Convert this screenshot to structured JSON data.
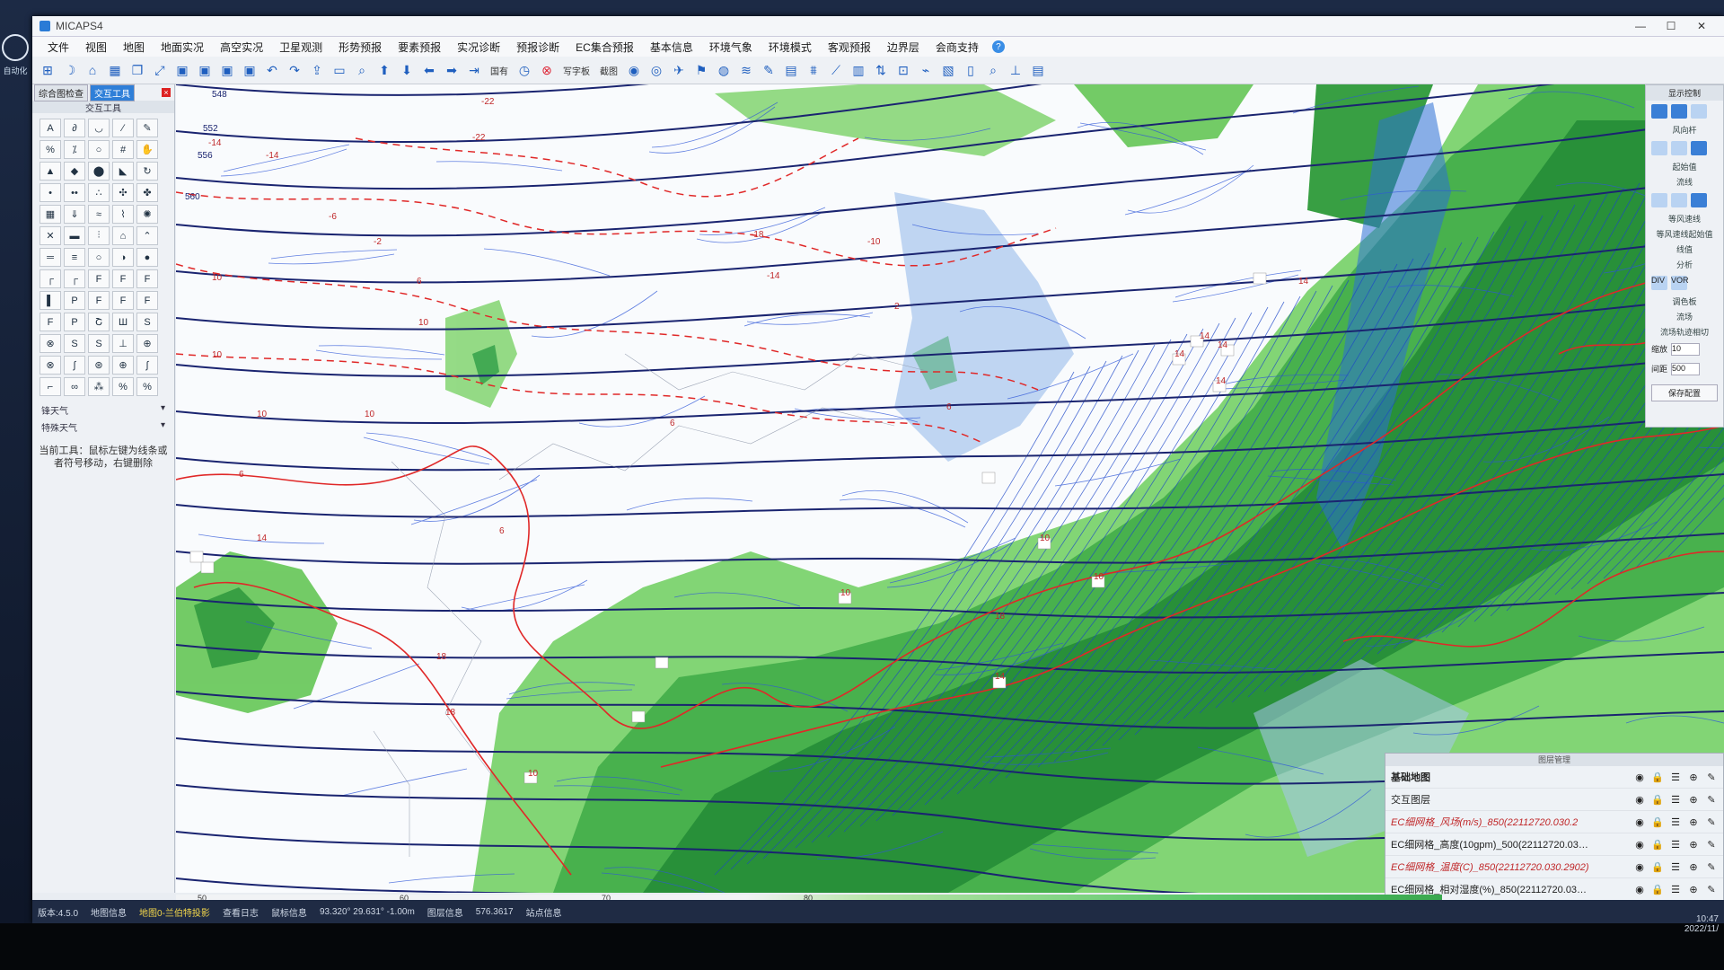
{
  "window": {
    "title": "MICAPS4"
  },
  "desktop": {
    "left_icon_label": "自动化"
  },
  "menu": [
    "文件",
    "视图",
    "地图",
    "地面实况",
    "高空实况",
    "卫星观测",
    "形势预报",
    "要素预报",
    "实况诊断",
    "预报诊断",
    "EC集合预报",
    "基本信息",
    "环境气象",
    "环境模式",
    "客观预报",
    "边界层",
    "会商支持"
  ],
  "toolbar": {
    "text_a": "国有",
    "text_b": "写字板",
    "text_c": "截图"
  },
  "left_panel": {
    "tabs": [
      "综合图检查",
      "交互工具"
    ],
    "header": "交互工具",
    "tool_glyphs": [
      "A",
      "∂",
      "◡",
      "∕",
      "✎",
      "%",
      "⁒",
      "○",
      "#",
      "✋",
      "▲",
      "◆",
      "⬤",
      "◣",
      "↻",
      "•",
      "••",
      "∴",
      "✣",
      "✤",
      "▦",
      "⇓",
      "≈",
      "⌇",
      "✺",
      "✕",
      "▬",
      "⫶",
      "⌂",
      "⌃",
      "═",
      "≡",
      "○",
      "◑",
      "●",
      "┌",
      "┌",
      "F",
      "F",
      "F",
      "▌",
      "P",
      "F",
      "F",
      "F",
      "F",
      "P",
      "Շ",
      "Ш",
      "S",
      "⊗",
      "S",
      "S",
      "⊥",
      "⊕",
      "⊗",
      "∫",
      "⊛",
      "⊕",
      "∫",
      "⌐",
      "∞",
      "⁂",
      "%",
      "%"
    ],
    "sub_a": "锋天气",
    "sub_b": "特殊天气",
    "hint": "当前工具：鼠标左键为线条或者符号移动，右键删除"
  },
  "right_panel": {
    "title": "显示控制",
    "labels": [
      "风向杆",
      "起始值",
      "流线",
      "等风速线",
      "等风速线起始值",
      "线值",
      "分析",
      "调色板",
      "DIV",
      "VOR",
      "流场",
      "流场轨迹相切",
      "缩放",
      "间距",
      "保存配置"
    ],
    "values": [
      "10",
      "500"
    ]
  },
  "layers": {
    "title": "图层管理",
    "items": [
      {
        "name": "基础地图",
        "style": "bold"
      },
      {
        "name": "交互图层",
        "style": "normal"
      },
      {
        "name": "EC细网格_风场(m/s)_850(22112720.030.2",
        "style": "red"
      },
      {
        "name": "EC细网格_高度(10gpm)_500(22112720.03…",
        "style": "normal"
      },
      {
        "name": "EC细网格_温度(C)_850(22112720.030.2902)",
        "style": "red"
      },
      {
        "name": "EC细网格_相对湿度(%)_850(22112720.03…",
        "style": "normal"
      }
    ]
  },
  "statusbar": {
    "version": "版本:4.5.0",
    "map_info": "地图信息",
    "projection": "地图0-兰伯特投影",
    "log": "查看日志",
    "coords_label": "鼠标信息",
    "coords": "93.320° 29.631° -1.00m",
    "legend_label": "图层信息",
    "legend_value": "576.3617",
    "station": "站点信息"
  },
  "longitudes": [
    "50",
    "60",
    "70",
    "80"
  ],
  "tray": {
    "time": "10:47",
    "date": "2022/11/"
  },
  "map_labels": {
    "height": [
      "548",
      "552",
      "556",
      "560"
    ],
    "temp": [
      "-22",
      "-14",
      "-14",
      "-22",
      "-18",
      "-6",
      "-2",
      "2",
      "6",
      "10",
      "10",
      "10",
      "10",
      "10",
      "-10",
      "-14",
      "14",
      "14",
      "14",
      "14",
      "14",
      "6",
      "6",
      "6",
      "10",
      "10",
      "10",
      "14",
      "18",
      "18",
      "18",
      "14",
      "10",
      "6"
    ]
  }
}
